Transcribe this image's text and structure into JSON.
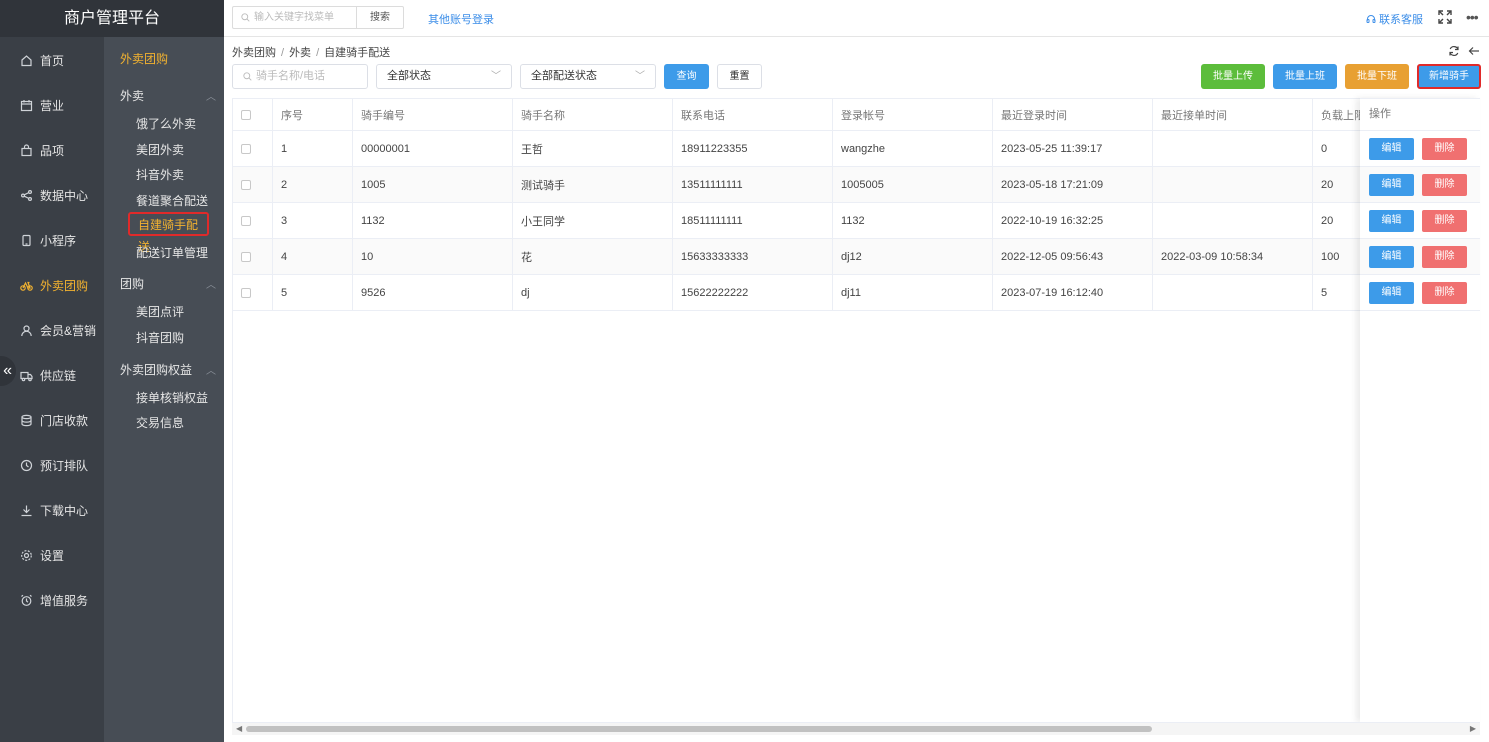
{
  "app": {
    "title": "商户管理平台"
  },
  "topbar": {
    "search_placeholder": "输入关键字找菜单",
    "search_button": "搜索",
    "other_login": "其他账号登录",
    "contact": "联系客服",
    "more": "•••"
  },
  "sidebar": {
    "items": [
      {
        "label": "首页",
        "icon": "home-icon"
      },
      {
        "label": "营业",
        "icon": "calendar-icon"
      },
      {
        "label": "品项",
        "icon": "bag-icon"
      },
      {
        "label": "数据中心",
        "icon": "share-icon"
      },
      {
        "label": "小程序",
        "icon": "phone-icon"
      },
      {
        "label": "外卖团购",
        "icon": "bike-icon",
        "active": true
      },
      {
        "label": "会员&营销",
        "icon": "user-icon"
      },
      {
        "label": "供应链",
        "icon": "truck-icon"
      },
      {
        "label": "门店收款",
        "icon": "database-icon"
      },
      {
        "label": "预订排队",
        "icon": "clock-icon"
      },
      {
        "label": "下载中心",
        "icon": "download-icon"
      },
      {
        "label": "设置",
        "icon": "gear-icon"
      },
      {
        "label": "增值服务",
        "icon": "alarm-icon"
      }
    ],
    "collapse": "«"
  },
  "subnav": {
    "title": "外卖团购",
    "groups": [
      {
        "label": "外卖",
        "items": [
          "饿了么外卖",
          "美团外卖",
          "抖音外卖",
          "餐道聚合配送",
          "自建骑手配送",
          "配送订单管理"
        ]
      },
      {
        "label": "团购",
        "items": [
          "美团点评",
          "抖音团购"
        ]
      },
      {
        "label": "外卖团购权益",
        "items": [
          "接单核销权益",
          "交易信息"
        ]
      }
    ],
    "active_item": "自建骑手配送"
  },
  "breadcrumb": [
    "外卖团购",
    "外卖",
    "自建骑手配送"
  ],
  "filters": {
    "rider_placeholder": "骑手名称/电话",
    "status": "全部状态",
    "delivery_status": "全部配送状态",
    "query": "查询",
    "reset": "重置"
  },
  "actions": {
    "batch_upload": "批量上传",
    "batch_on": "批量上班",
    "batch_off": "批量下班",
    "add_rider": "新增骑手"
  },
  "table": {
    "headers": [
      "序号",
      "骑手编号",
      "骑手名称",
      "联系电话",
      "登录帐号",
      "最近登录时间",
      "最近接单时间",
      "负载上限"
    ],
    "op_header": "操作",
    "edit": "编辑",
    "delete": "删除",
    "rows": [
      [
        "1",
        "00000001",
        "王哲",
        "18911223355",
        "wangzhe",
        "2023-05-25 11:39:17",
        "",
        "0"
      ],
      [
        "2",
        "1005",
        "测试骑手",
        "13511111111",
        "1005005",
        "2023-05-18 17:21:09",
        "",
        "20"
      ],
      [
        "3",
        "1132",
        "小王同学",
        "18511111111",
        "1132",
        "2022-10-19 16:32:25",
        "",
        "20"
      ],
      [
        "4",
        "10",
        "花",
        "15633333333",
        "dj12",
        "2022-12-05 09:56:43",
        "2022-03-09 10:58:34",
        "100"
      ],
      [
        "5",
        "9526",
        "dj",
        "15622222222",
        "dj11",
        "2023-07-19 16:12:40",
        "",
        "5"
      ]
    ]
  },
  "colors": {
    "accent": "#3d9be9",
    "active": "#f2b230",
    "sidebar": "#3a3f46",
    "subnav": "#474d55"
  }
}
